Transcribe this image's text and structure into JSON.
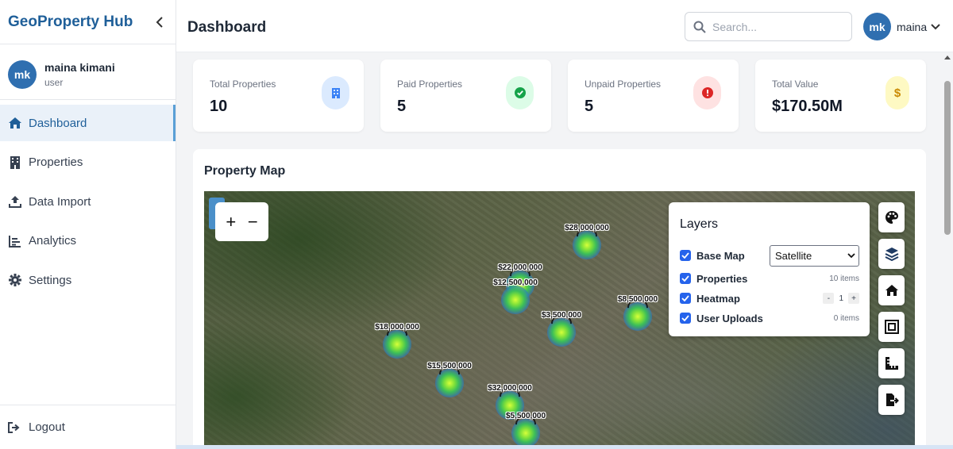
{
  "app": {
    "brand": "GeoProperty Hub"
  },
  "user": {
    "initials": "mk",
    "name": "maina kimani",
    "role": "user",
    "short_name": "maina"
  },
  "sidebar": {
    "items": [
      {
        "label": "Dashboard",
        "icon": "home-icon",
        "active": true
      },
      {
        "label": "Properties",
        "icon": "building-icon",
        "active": false
      },
      {
        "label": "Data Import",
        "icon": "upload-icon",
        "active": false
      },
      {
        "label": "Analytics",
        "icon": "chart-icon",
        "active": false
      },
      {
        "label": "Settings",
        "icon": "gear-icon",
        "active": false
      }
    ],
    "logout_label": "Logout"
  },
  "header": {
    "title": "Dashboard",
    "search_placeholder": "Search..."
  },
  "stats": [
    {
      "label": "Total Properties",
      "value": "10",
      "icon": "building-icon",
      "color": "#dbeafe"
    },
    {
      "label": "Paid Properties",
      "value": "5",
      "icon": "check-circle-icon",
      "color": "#dcfce7"
    },
    {
      "label": "Unpaid Properties",
      "value": "5",
      "icon": "alert-circle-icon",
      "color": "#fee2e2"
    },
    {
      "label": "Total Value",
      "value": "$170.50M",
      "icon": "dollar-icon",
      "color": "#fef9c3"
    }
  ],
  "map": {
    "title": "Property Map",
    "markers": [
      "$28,000,000",
      "$22,000,000",
      "$12,500,000",
      "$8,500,000",
      "$3,500,000",
      "$18,000,000",
      "$15,500,000",
      "$32,000,000",
      "$5,500,000"
    ],
    "layers": {
      "title": "Layers",
      "base_map_label": "Base Map",
      "base_map_value": "Satellite",
      "properties_label": "Properties",
      "properties_count": "10 items",
      "heatmap_label": "Heatmap",
      "heatmap_value": "1",
      "uploads_label": "User Uploads",
      "uploads_count": "0 items"
    }
  },
  "colors": {
    "brand": "#1f5f99",
    "accent": "#2f6fb0",
    "checkbox": "#2563eb"
  }
}
